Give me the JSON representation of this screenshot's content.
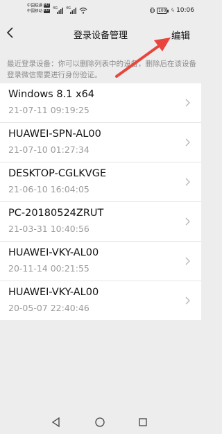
{
  "status_bar": {
    "carrier1": "中国联通",
    "carrier2": "中国移动",
    "hd_label": "HD",
    "sig1_label": "4G",
    "sig2_label": "4G",
    "battery": "100",
    "time": "10:06"
  },
  "nav": {
    "title": "登录设备管理",
    "edit_label": "编辑"
  },
  "notice": "最近登录设备：你可以删除列表中的设备，删除后在该设备登录微信需要进行身份验证。",
  "devices": [
    {
      "name": "Windows 8.1 x64",
      "time": "21-07-11 09:19:25"
    },
    {
      "name": "HUAWEI-SPN-AL00",
      "time": "21-07-10 01:27:34"
    },
    {
      "name": "DESKTOP-CGLKVGE",
      "time": "21-06-10 16:04:05"
    },
    {
      "name": "PC-20180524ZRUT",
      "time": "21-03-31 10:40:56"
    },
    {
      "name": "HUAWEI-VKY-AL00",
      "time": "20-11-14 00:21:55"
    },
    {
      "name": "HUAWEI-VKY-AL00",
      "time": "20-05-07 22:40:46"
    }
  ],
  "colors": {
    "annotation_arrow": "#e8453c",
    "background": "#ededed"
  },
  "icons": {
    "back": "back-arrow-icon",
    "chevron": "chevron-right-icon",
    "sys_back": "triangle-back-icon",
    "sys_home": "circle-home-icon",
    "sys_recent": "square-recent-icon"
  }
}
